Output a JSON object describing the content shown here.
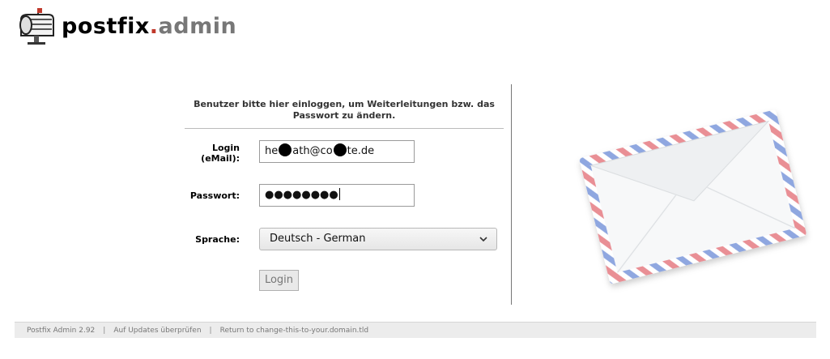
{
  "brand": {
    "name_part1": "postfix",
    "dot": ".",
    "name_part2": "admin"
  },
  "login": {
    "intro": "Benutzer bitte hier einloggen, um Weiterleitungen bzw. das Passwort zu ändern.",
    "login_label_line1": "Login",
    "login_label_line2": "(eMail):",
    "email_value_part1": "he",
    "email_value_part2": "ath@co",
    "email_value_part3": "te.de",
    "password_label": "Passwort:",
    "password_value": "●●●●●●●●",
    "language_label": "Sprache:",
    "language_selected": "Deutsch - German",
    "submit_label": "Login"
  },
  "footer": {
    "version": "Postfix Admin 2.92",
    "separator": "|",
    "updates_link": "Auf Updates überprüfen",
    "return_link": "Return to change-this-to-your.domain.tld"
  },
  "colors": {
    "brand_dot": "#c0392b",
    "brand_admin": "#777777",
    "footer_bg": "#ececec"
  },
  "icons": {
    "logo": "mailbox-icon",
    "select_arrow": "chevron-down-icon",
    "illustration": "envelope-illustration"
  }
}
